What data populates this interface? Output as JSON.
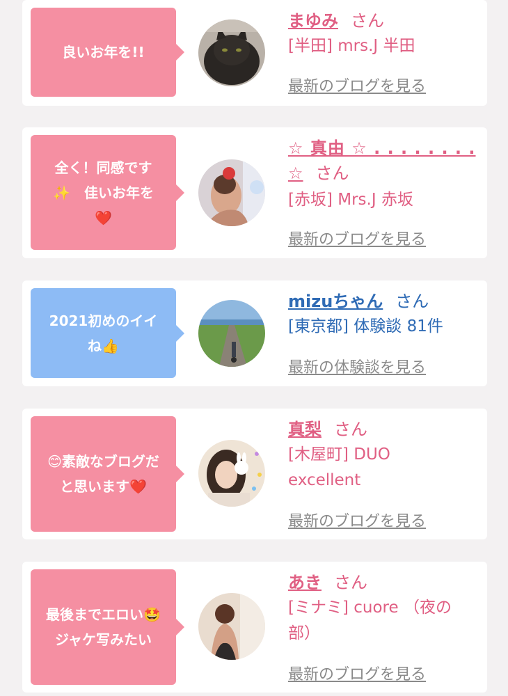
{
  "colors": {
    "pink_bubble": "#f58fa2",
    "blue_bubble": "#8dbbf5",
    "pink_text": "#e05f83",
    "blue_text": "#2f6bb5",
    "link_gray": "#8a8a8a"
  },
  "cards": [
    {
      "message": "良いお年を!!",
      "name": "まゆみ",
      "honorific": "さん",
      "shop": "[半田] mrs.J 半田",
      "link": "最新のブログを見る",
      "avatar": "black-cat-avatar"
    },
    {
      "message": "全く！同感です\n✨　佳いお年を\n❤️",
      "name_line1": "☆ 真由 ☆ . . . . . . . .",
      "name_line2": "☆",
      "honorific": "さん",
      "shop": "[赤坂] Mrs.J 赤坂",
      "link": "最新のブログを見る",
      "avatar": "woman-red-flower-avatar"
    },
    {
      "message": "2021初めのイイ\nね👍",
      "name": "mizuちゃん",
      "honorific": "さん",
      "shop": "[東京都] 体験談 81件",
      "link": "最新の体験談を見る",
      "avatar": "road-landscape-avatar"
    },
    {
      "message": "😊素敵なブログだ\nと思います❤️",
      "name": "真梨",
      "honorific": "さん",
      "shop_line1": "[木屋町] DUO",
      "shop_line2": "excellent",
      "link": "最新のブログを見る",
      "avatar": "woman-bunny-sticker-avatar"
    },
    {
      "message": "最後までエロい🤩\nジャケ写みたい",
      "name": "あき",
      "honorific": "さん",
      "shop_line1": "[ミナミ] cuore （夜の",
      "shop_line2": "部）",
      "link": "最新のブログを見る",
      "avatar": "woman-back-avatar"
    }
  ]
}
